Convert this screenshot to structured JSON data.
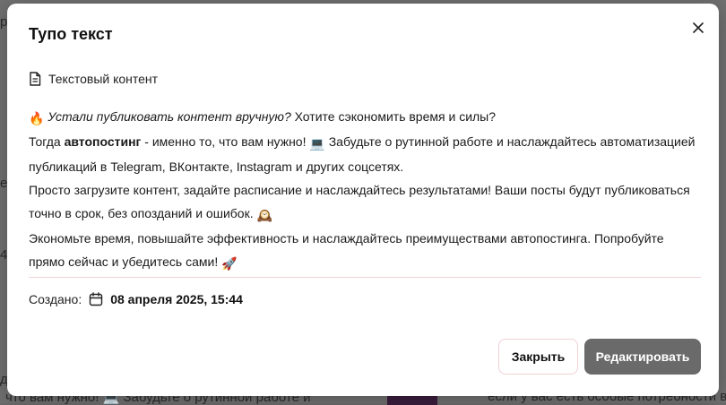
{
  "background": {
    "fragments": {
      "left_top": "р",
      "left_mid1": "е",
      "left_mid2": "4",
      "left_mid3": "д",
      "bottom": "что вам нужно! 💻 Забудьте о рутинной работе и",
      "bottom_right": "если у вас есть особые потребности в п"
    }
  },
  "modal": {
    "title": "Тупо текст",
    "close_glyph": "✕",
    "content_type_label": "Текстовый контент",
    "post": {
      "p1_emoji": "🔥",
      "p1_italic": "Устали публиковать контент вручную?",
      "p1_rest": " Хотите сэкономить время и силы?",
      "p2_a": "Тогда ",
      "p2_bold": "автопостинг",
      "p2_b": " - именно то, что вам нужно! ",
      "p2_emoji": "💻",
      "p2_c": " Забудьте о рутинной работе и наслаждайтесь автоматизацией публикаций в Telegram, ВКонтакте, Instagram и других соцсетях.",
      "p3_a": "Просто загрузите контент, задайте расписание и наслаждайтесь результатами! Ваши посты будут публиковаться точно в срок, без опозданий и ошибок. ",
      "p3_emoji": "🕰️",
      "p4_a": "Экономьте время, повышайте эффективность и наслаждайтесь преимуществами автопостинга. Попробуйте прямо сейчас и убедитесь сами! ",
      "p4_emoji": "🚀"
    },
    "created_label": "Создано:",
    "created_date": "08 апреля 2025, 15:44",
    "buttons": {
      "close": "Закрыть",
      "edit": "Редактировать"
    }
  },
  "colors": {
    "overlay": "#707070",
    "divider": "#f1d3d6",
    "primary_button": "#6a6a6a",
    "close_button_border": "#f0d0d4"
  }
}
